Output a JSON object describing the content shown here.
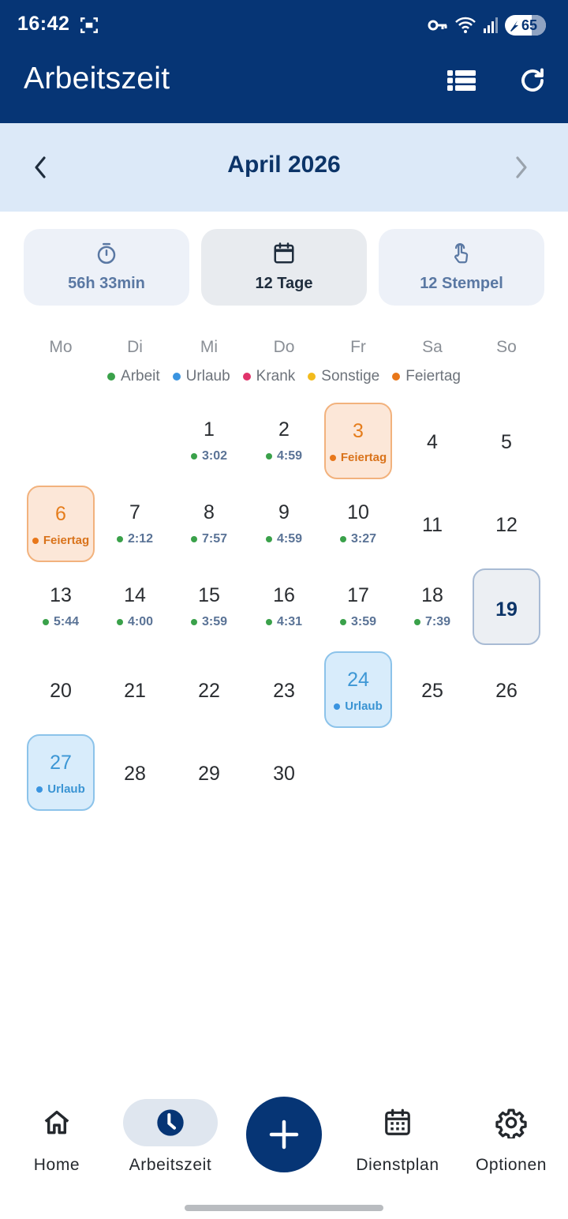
{
  "status_bar": {
    "time": "16:42",
    "battery": "65"
  },
  "header": {
    "title": "Arbeitszeit"
  },
  "month_nav": {
    "title": "April 2026"
  },
  "summary": [
    {
      "label": "56h 33min",
      "icon": "timer-icon"
    },
    {
      "label": "12 Tage",
      "icon": "calendar-icon"
    },
    {
      "label": "12 Stempel",
      "icon": "touch-icon"
    }
  ],
  "weekdays": [
    "Mo",
    "Di",
    "Mi",
    "Do",
    "Fr",
    "Sa",
    "So"
  ],
  "legend": [
    {
      "label": "Arbeit",
      "color": "#3aa14a"
    },
    {
      "label": "Urlaub",
      "color": "#3a94e0"
    },
    {
      "label": "Krank",
      "color": "#e0336b"
    },
    {
      "label": "Sonstige",
      "color": "#f2bb1d"
    },
    {
      "label": "Feiertag",
      "color": "#e8771a"
    }
  ],
  "calendar": {
    "days": [
      {
        "day": "1",
        "meta": "3:02",
        "type": "arbeit"
      },
      {
        "day": "2",
        "meta": "4:59",
        "type": "arbeit"
      },
      {
        "day": "3",
        "meta": "Feiertag",
        "type": "feiertag"
      },
      {
        "day": "4",
        "meta": "",
        "type": "none"
      },
      {
        "day": "5",
        "meta": "",
        "type": "none"
      },
      {
        "day": "6",
        "meta": "Feiertag",
        "type": "feiertag"
      },
      {
        "day": "7",
        "meta": "2:12",
        "type": "arbeit"
      },
      {
        "day": "8",
        "meta": "7:57",
        "type": "arbeit"
      },
      {
        "day": "9",
        "meta": "4:59",
        "type": "arbeit"
      },
      {
        "day": "10",
        "meta": "3:27",
        "type": "arbeit"
      },
      {
        "day": "11",
        "meta": "",
        "type": "none"
      },
      {
        "day": "12",
        "meta": "",
        "type": "none"
      },
      {
        "day": "13",
        "meta": "5:44",
        "type": "arbeit"
      },
      {
        "day": "14",
        "meta": "4:00",
        "type": "arbeit"
      },
      {
        "day": "15",
        "meta": "3:59",
        "type": "arbeit"
      },
      {
        "day": "16",
        "meta": "4:31",
        "type": "arbeit"
      },
      {
        "day": "17",
        "meta": "3:59",
        "type": "arbeit"
      },
      {
        "day": "18",
        "meta": "7:39",
        "type": "arbeit"
      },
      {
        "day": "19",
        "meta": "",
        "type": "today"
      },
      {
        "day": "20",
        "meta": "",
        "type": "none"
      },
      {
        "day": "21",
        "meta": "",
        "type": "none"
      },
      {
        "day": "22",
        "meta": "",
        "type": "none"
      },
      {
        "day": "23",
        "meta": "",
        "type": "none"
      },
      {
        "day": "24",
        "meta": "Urlaub",
        "type": "urlaub"
      },
      {
        "day": "25",
        "meta": "",
        "type": "none"
      },
      {
        "day": "26",
        "meta": "",
        "type": "none"
      },
      {
        "day": "27",
        "meta": "Urlaub",
        "type": "urlaub"
      },
      {
        "day": "28",
        "meta": "",
        "type": "none"
      },
      {
        "day": "29",
        "meta": "",
        "type": "none"
      },
      {
        "day": "30",
        "meta": "",
        "type": "none"
      }
    ]
  },
  "bottom_nav": [
    {
      "label": "Home",
      "icon": "home-icon"
    },
    {
      "label": "Arbeitszeit",
      "icon": "clock-icon"
    },
    {
      "label": "Dienstplan",
      "icon": "calendar-grid-icon"
    },
    {
      "label": "Optionen",
      "icon": "gear-icon"
    }
  ],
  "colors": {
    "primary": "#063575",
    "arbeit": "#3aa14a",
    "urlaub": "#3a94e0",
    "feiertag": "#e8771a"
  }
}
